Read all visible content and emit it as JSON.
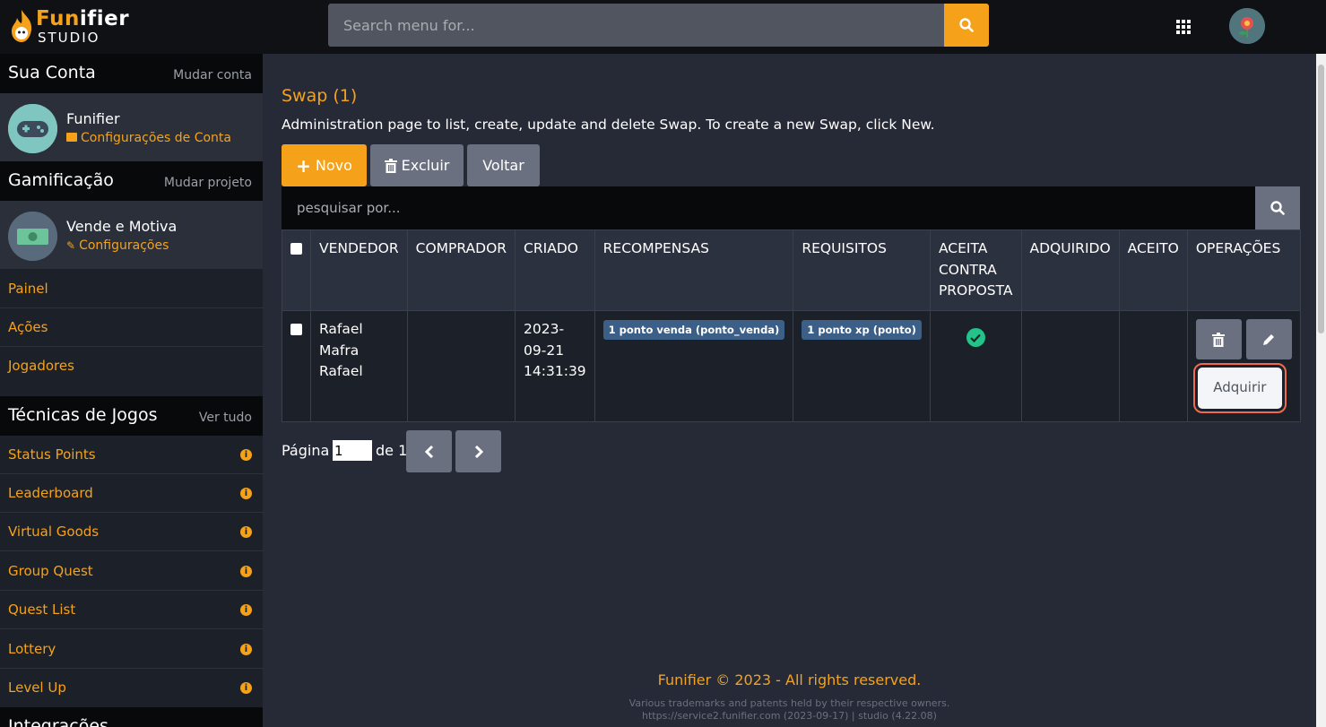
{
  "header": {
    "brand_a": "Fun",
    "brand_b": "ifier",
    "brand_sub": "STUDIO",
    "search_placeholder": "Search menu for..."
  },
  "sidebar": {
    "account_title": "Sua Conta",
    "account_switch": "Mudar conta",
    "account_name": "Funifier",
    "account_settings": "Configurações de Conta",
    "gamification_title": "Gamificação",
    "gamification_switch": "Mudar projeto",
    "project_name": "Vende e Motiva",
    "project_settings": "Configurações",
    "nav": [
      {
        "label": "Painel"
      },
      {
        "label": "Ações"
      },
      {
        "label": "Jogadores"
      }
    ],
    "techniques_title": "Técnicas de Jogos",
    "techniques_link": "Ver tudo",
    "techniques": [
      {
        "label": "Status Points"
      },
      {
        "label": "Leaderboard"
      },
      {
        "label": "Virtual Goods"
      },
      {
        "label": "Group Quest"
      },
      {
        "label": "Quest List"
      },
      {
        "label": "Lottery"
      },
      {
        "label": "Level Up"
      }
    ],
    "integrations_title": "Integrações"
  },
  "main": {
    "title": "Swap (1)",
    "description": "Administration page to list, create, update and delete Swap. To create a new Swap, click New.",
    "buttons": {
      "new": "Novo",
      "delete": "Excluir",
      "back": "Voltar"
    },
    "search_placeholder": "pesquisar por...",
    "table": {
      "columns": [
        "VENDEDOR",
        "COMPRADOR",
        "CRIADO",
        "RECOMPENSAS",
        "REQUISITOS",
        "ACEITA CONTRA PROPOSTA",
        "ADQUIRIDO",
        "ACEITO",
        "OPERAÇÕES"
      ],
      "rows": [
        {
          "vendedor": "Rafael Mafra Rafael",
          "comprador": "",
          "criado": "2023-09-21 14:31:39",
          "recompensas": "1 ponto venda (ponto_venda)",
          "requisitos": "1 ponto xp (ponto)",
          "aceita_contra_proposta": true,
          "adquirido": "",
          "aceito": "",
          "acquire_label": "Adquirir"
        }
      ]
    },
    "pager": {
      "label": "Página",
      "current": "1",
      "of_label": "de 1"
    }
  },
  "footer": {
    "copyright": "Funifier © 2023 - All rights reserved.",
    "trademarks": "Various trademarks and patents held by their respective owners.",
    "version": "https://service2.funifier.com (2023-09-17) | studio (4.22.08)"
  },
  "colors": {
    "accent": "#f5a21a",
    "success": "#23c38a",
    "badge": "#3b5f87",
    "highlight": "#f06a4e"
  }
}
